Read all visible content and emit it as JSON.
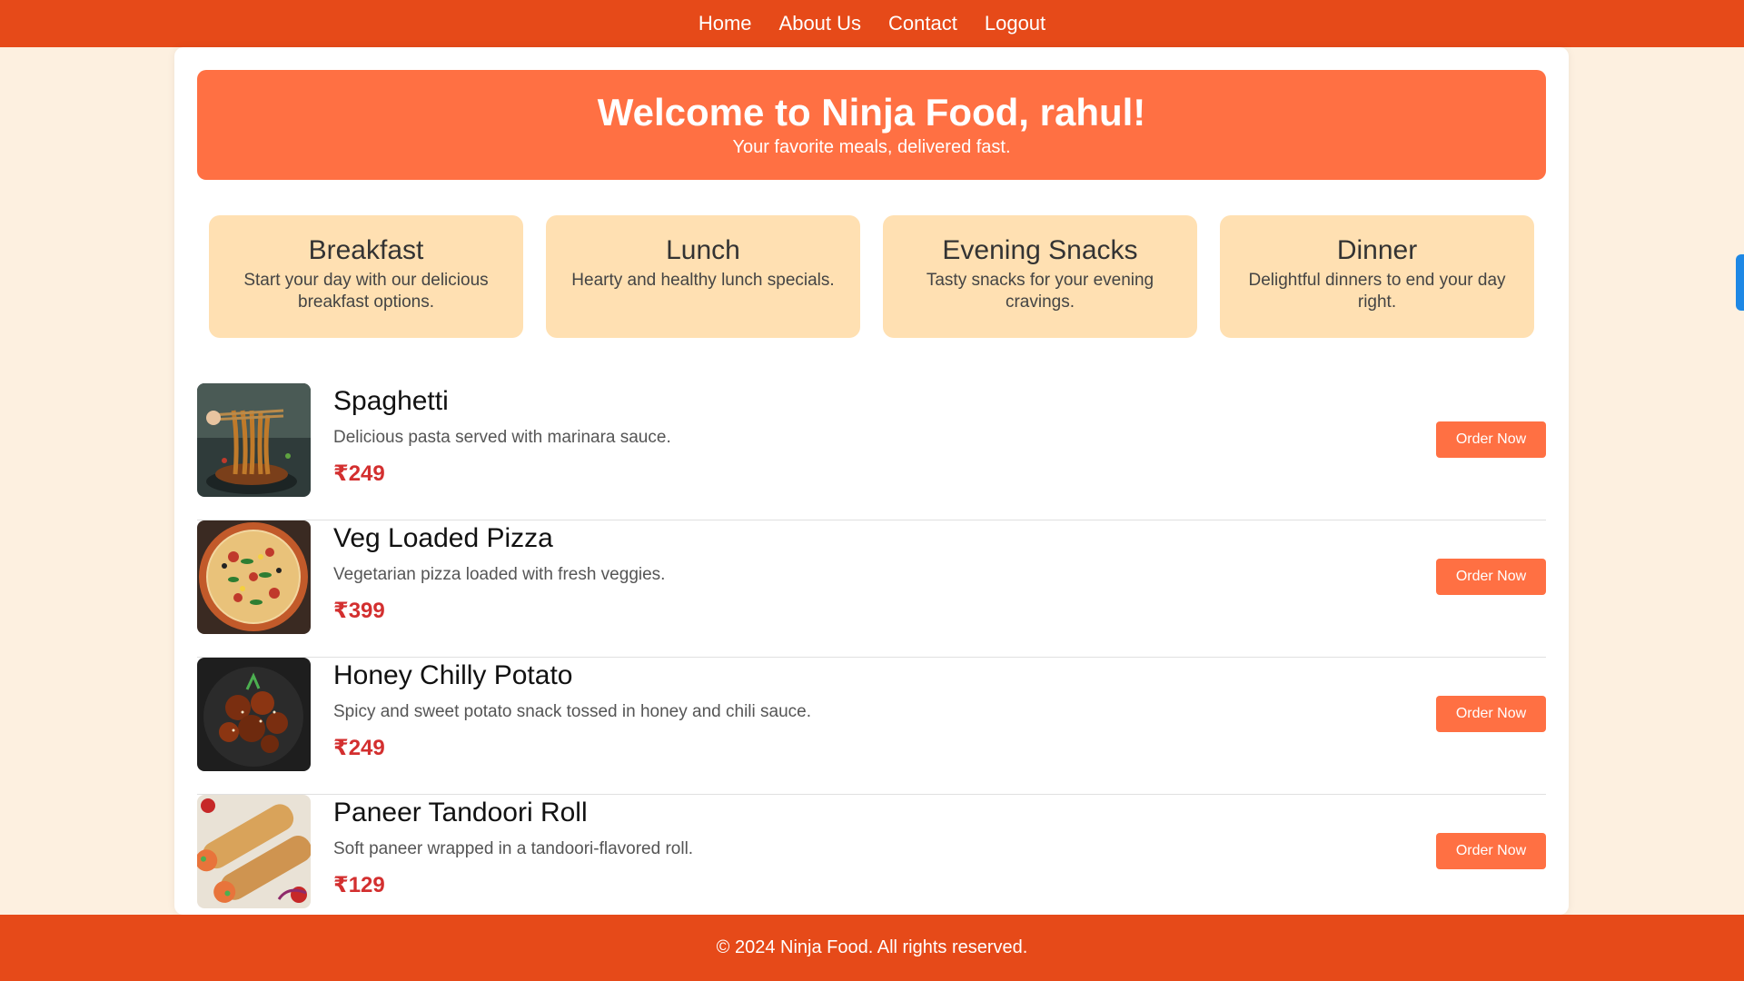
{
  "nav": {
    "links": [
      "Home",
      "About Us",
      "Contact",
      "Logout"
    ]
  },
  "hero": {
    "title": "Welcome to Ninja Food, rahul!",
    "subtitle": "Your favorite meals, delivered fast."
  },
  "categories": [
    {
      "title": "Breakfast",
      "desc": "Start your day with our delicious breakfast options."
    },
    {
      "title": "Lunch",
      "desc": "Hearty and healthy lunch specials."
    },
    {
      "title": "Evening Snacks",
      "desc": "Tasty snacks for your evening cravings."
    },
    {
      "title": "Dinner",
      "desc": "Delightful dinners to end your day right."
    }
  ],
  "menu": [
    {
      "name": "Spaghetti",
      "desc": "Delicious pasta served with marinara sauce.",
      "price": "₹249",
      "button": "Order Now",
      "image_icon": "spaghetti-image"
    },
    {
      "name": "Veg Loaded Pizza",
      "desc": "Vegetarian pizza loaded with fresh veggies.",
      "price": "₹399",
      "button": "Order Now",
      "image_icon": "pizza-image"
    },
    {
      "name": "Honey Chilly Potato",
      "desc": "Spicy and sweet potato snack tossed in honey and chili sauce.",
      "price": "₹249",
      "button": "Order Now",
      "image_icon": "chilly-potato-image"
    },
    {
      "name": "Paneer Tandoori Roll",
      "desc": "Soft paneer wrapped in a tandoori-flavored roll.",
      "price": "₹129",
      "button": "Order Now",
      "image_icon": "tandoori-roll-image"
    }
  ],
  "footer": {
    "text": "© 2024 Ninja Food. All rights reserved."
  },
  "colors": {
    "nav": "#e64a19",
    "hero": "#ff7043",
    "category": "#ffe0b2",
    "price": "#d32f2f",
    "page_bg": "#fdf0e0"
  }
}
